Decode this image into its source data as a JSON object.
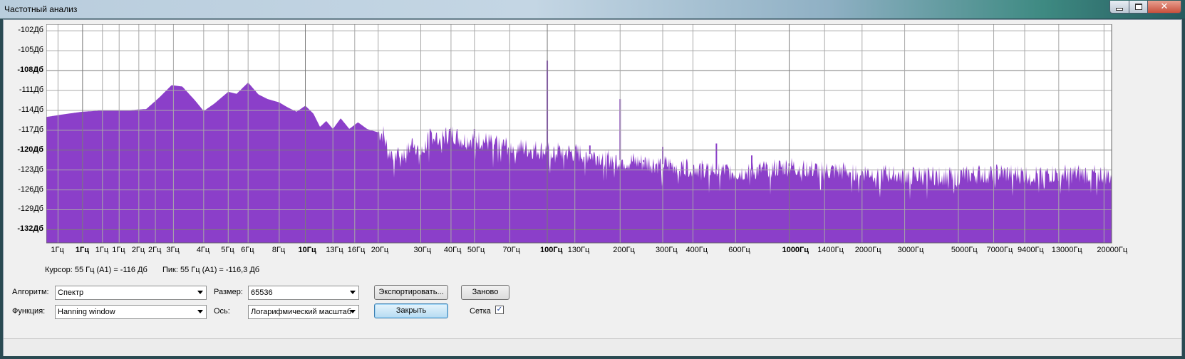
{
  "window": {
    "title": "Частотный анализ"
  },
  "chart_data": {
    "type": "area",
    "x_scale": "log",
    "xlim": [
      0.85,
      21500
    ],
    "ylim": [
      -134,
      -101
    ],
    "grid": true,
    "color": "#8b3fc9",
    "y_ticks": [
      {
        "v": -102,
        "label": "-102Дб",
        "bold": false
      },
      {
        "v": -105,
        "label": "-105Дб",
        "bold": false
      },
      {
        "v": -108,
        "label": "-108Дб",
        "bold": true
      },
      {
        "v": -111,
        "label": "-111Дб",
        "bold": false
      },
      {
        "v": -114,
        "label": "-114Дб",
        "bold": false
      },
      {
        "v": -117,
        "label": "-117Дб",
        "bold": false
      },
      {
        "v": -120,
        "label": "-120Дб",
        "bold": true
      },
      {
        "v": -123,
        "label": "-123Дб",
        "bold": false
      },
      {
        "v": -126,
        "label": "-126Дб",
        "bold": false
      },
      {
        "v": -129,
        "label": "-129Дб",
        "bold": false
      },
      {
        "v": -132,
        "label": "-132Дб",
        "bold": true
      }
    ],
    "x_ticks": [
      {
        "v": 0.95,
        "label": "1Гц",
        "bold": false
      },
      {
        "v": 1.2,
        "label": "1Гц",
        "bold": true
      },
      {
        "v": 1.45,
        "label": "1Гц",
        "bold": false
      },
      {
        "v": 1.7,
        "label": "1Гц",
        "bold": false
      },
      {
        "v": 2.05,
        "label": "2Гц",
        "bold": false
      },
      {
        "v": 2.4,
        "label": "2Гц",
        "bold": false
      },
      {
        "v": 2.85,
        "label": "3Гц",
        "bold": false
      },
      {
        "v": 3.8,
        "label": "4Гц",
        "bold": false
      },
      {
        "v": 4.8,
        "label": "5Гц",
        "bold": false
      },
      {
        "v": 5.8,
        "label": "6Гц",
        "bold": false
      },
      {
        "v": 7.8,
        "label": "8Гц",
        "bold": false
      },
      {
        "v": 10,
        "label": "10Гц",
        "bold": true
      },
      {
        "v": 13,
        "label": "13Гц",
        "bold": false
      },
      {
        "v": 16,
        "label": "16Гц",
        "bold": false
      },
      {
        "v": 20,
        "label": "20Гц",
        "bold": false
      },
      {
        "v": 30,
        "label": "30Гц",
        "bold": false
      },
      {
        "v": 40,
        "label": "40Гц",
        "bold": false
      },
      {
        "v": 50,
        "label": "50Гц",
        "bold": false
      },
      {
        "v": 70,
        "label": "70Гц",
        "bold": false
      },
      {
        "v": 100,
        "label": "100Гц",
        "bold": true
      },
      {
        "v": 130,
        "label": "130Гц",
        "bold": false
      },
      {
        "v": 200,
        "label": "200Гц",
        "bold": false
      },
      {
        "v": 300,
        "label": "300Гц",
        "bold": false
      },
      {
        "v": 400,
        "label": "400Гц",
        "bold": false
      },
      {
        "v": 600,
        "label": "600Гц",
        "bold": false
      },
      {
        "v": 1000,
        "label": "1000Гц",
        "bold": true
      },
      {
        "v": 1400,
        "label": "1400Гц",
        "bold": false
      },
      {
        "v": 2000,
        "label": "2000Гц",
        "bold": false
      },
      {
        "v": 3000,
        "label": "3000Гц",
        "bold": false
      },
      {
        "v": 5000,
        "label": "5000Гц",
        "bold": false
      },
      {
        "v": 7000,
        "label": "7000Гц",
        "bold": false
      },
      {
        "v": 9400,
        "label": "9400Гц",
        "bold": false
      },
      {
        "v": 13000,
        "label": "13000Гц",
        "bold": false
      },
      {
        "v": 20000,
        "label": "20000Гц",
        "bold": false
      }
    ],
    "envelope": [
      [
        0.85,
        -115.0
      ],
      [
        1.0,
        -114.6
      ],
      [
        1.2,
        -114.2
      ],
      [
        1.5,
        -114.0
      ],
      [
        1.8,
        -114.0
      ],
      [
        2.2,
        -113.8
      ],
      [
        2.5,
        -112.0
      ],
      [
        2.8,
        -110.2
      ],
      [
        3.1,
        -110.4
      ],
      [
        3.5,
        -112.5
      ],
      [
        3.8,
        -114.1
      ],
      [
        4.2,
        -113.0
      ],
      [
        4.8,
        -111.2
      ],
      [
        5.2,
        -111.5
      ],
      [
        5.8,
        -109.8
      ],
      [
        6.4,
        -111.6
      ],
      [
        7.0,
        -112.3
      ],
      [
        7.8,
        -112.8
      ],
      [
        8.5,
        -113.6
      ],
      [
        9.2,
        -114.2
      ],
      [
        10.0,
        -113.3
      ],
      [
        10.8,
        -114.5
      ],
      [
        11.5,
        -116.5
      ],
      [
        12.2,
        -115.6
      ],
      [
        13.0,
        -116.8
      ],
      [
        14.0,
        -115.2
      ],
      [
        15.2,
        -116.8
      ],
      [
        16.5,
        -115.8
      ],
      [
        18.0,
        -116.8
      ],
      [
        19.5,
        -117.2
      ],
      [
        21.0,
        -117.5
      ],
      [
        22.0,
        -120.4
      ],
      [
        24.0,
        -120.0
      ],
      [
        26.0,
        -120.8
      ],
      [
        28.0,
        -118.5
      ],
      [
        30.0,
        -120.8
      ],
      [
        33.0,
        -117.5
      ],
      [
        36.0,
        -118.4
      ],
      [
        40.0,
        -117.3
      ],
      [
        45.0,
        -118.5
      ],
      [
        50.0,
        -118.2
      ],
      [
        60.0,
        -119.0
      ],
      [
        70.0,
        -119.4
      ],
      [
        85.0,
        -119.8
      ],
      [
        100.0,
        -120.0
      ],
      [
        150.0,
        -120.6
      ],
      [
        200.0,
        -121.5
      ],
      [
        300.0,
        -122.1
      ],
      [
        400.0,
        -122.5
      ],
      [
        600.0,
        -123.3
      ],
      [
        800.0,
        -122.9
      ],
      [
        1000.0,
        -122.4
      ],
      [
        1400.0,
        -123.1
      ],
      [
        2000.0,
        -123.2
      ],
      [
        3000.0,
        -123.8
      ],
      [
        5000.0,
        -123.8
      ],
      [
        7000.0,
        -123.4
      ],
      [
        9400.0,
        -123.6
      ],
      [
        13000.0,
        -123.5
      ],
      [
        20000.0,
        -123.6
      ],
      [
        21500.0,
        -124.0
      ]
    ],
    "spikes": [
      [
        100,
        -106.5
      ],
      [
        50,
        -116.8
      ],
      [
        150,
        -119.3
      ],
      [
        200,
        -112.3
      ],
      [
        250,
        -121.5
      ],
      [
        300,
        -119.5
      ],
      [
        500,
        -119.0
      ],
      [
        700,
        -120.8
      ],
      [
        1000,
        -122.0
      ]
    ]
  },
  "readout": {
    "cursor": "Курсор: 55 Гц (A1) = -116 Дб",
    "peak": "Пик: 55 Гц (A1) = -116,3 Дб"
  },
  "controls": {
    "algorithm_label": "Алгоритм:",
    "algorithm_value": "Спектр",
    "function_label": "Функция:",
    "function_value": "Hanning window",
    "size_label": "Размер:",
    "size_value": "65536",
    "axis_label": "Ось:",
    "axis_value": "Логарифмический масштаб",
    "export_label": "Экспортировать...",
    "reset_label": "Заново",
    "close_label": "Закрыть",
    "grid_label": "Сетка",
    "grid_checked": true
  }
}
